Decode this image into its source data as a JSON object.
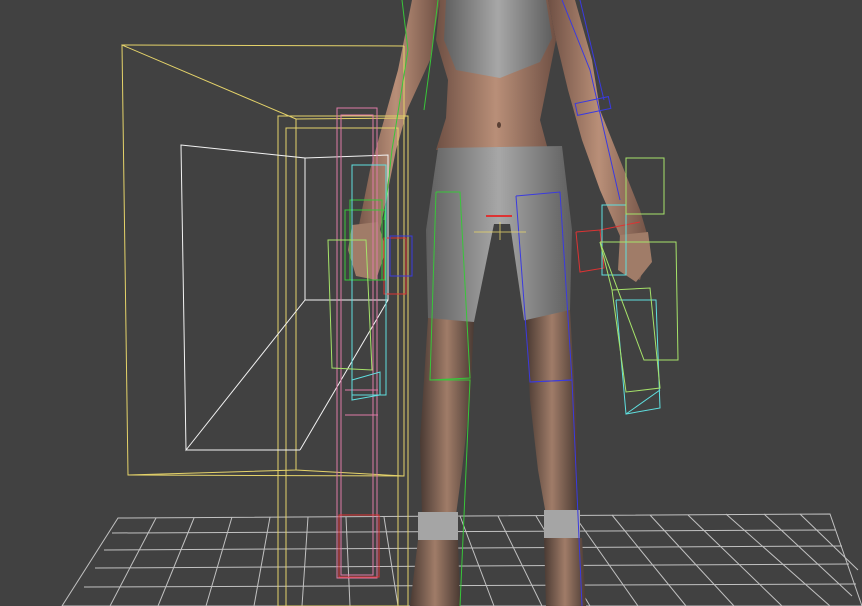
{
  "viewport": {
    "background": "#414141",
    "grid_color": "#d8d8d8",
    "bone_colors": {
      "yellow": "#e5d36a",
      "white": "#f2f2f2",
      "pink": "#e07aa8",
      "red": "#d33",
      "green": "#38c63a",
      "blue": "#3a3ae0",
      "cyan": "#5fe0e0",
      "lime": "#a6e36a",
      "orange": "#e88a4a"
    },
    "character": {
      "skin": "#b98f78",
      "skin_dark": "#8a6656",
      "cloth": "#9d9d9d",
      "cloth_dark": "#6f6f6f"
    }
  }
}
